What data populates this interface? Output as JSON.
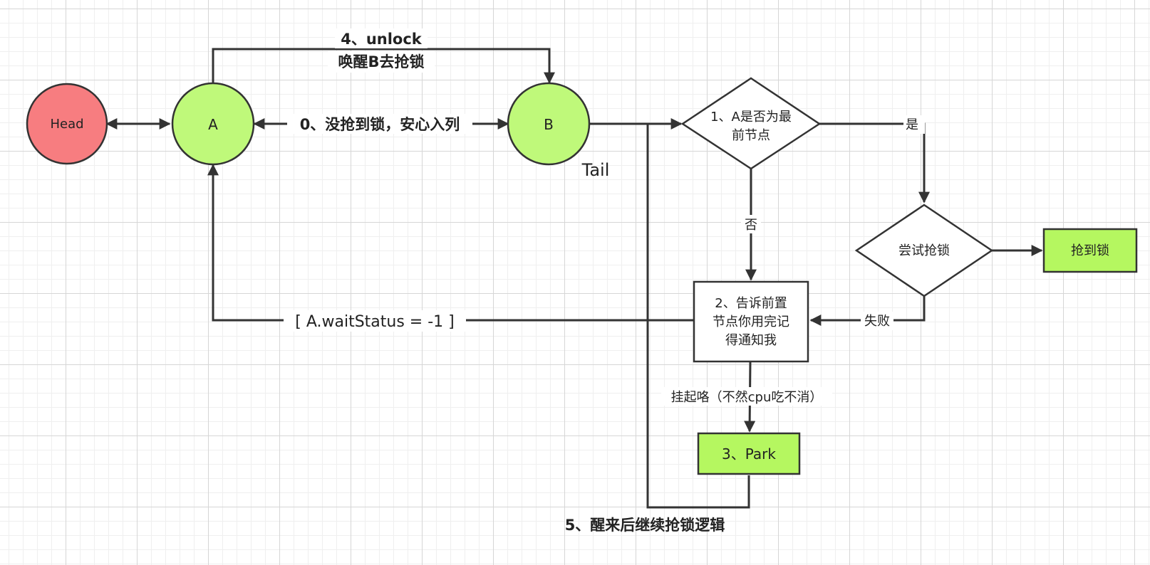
{
  "colors": {
    "head_fill": "#f77d80",
    "node_fill": "#bff97a",
    "box_fill": "#b5f760",
    "stroke": "#333333",
    "grid": "#d6d6d6"
  },
  "nodes": {
    "head": "Head",
    "a": "A",
    "b": "B",
    "tail": "Tail",
    "decision_first": [
      "1、A是否为最",
      "前节点"
    ],
    "decision_try": "尝试抢锁",
    "got_lock": "抢到锁",
    "tell_prev": [
      "2、告诉前置",
      "节点你用完记",
      "得通知我"
    ],
    "park": "3、Park"
  },
  "edges": {
    "unlock": "4、unlock",
    "wake_b": "唤醒B去抢锁",
    "enqueue": "0、没抢到锁，安心入列",
    "yes": "是",
    "no": "否",
    "fail": "失败",
    "wait_status": "[ A.waitStatus = -1 ]",
    "suspend": "挂起咯（不然cpu吃不消）",
    "wake_continue": "5、醒来后继续抢锁逻辑"
  }
}
